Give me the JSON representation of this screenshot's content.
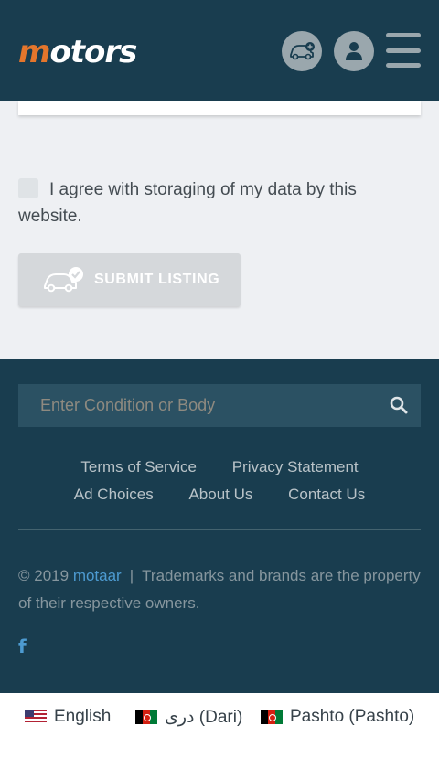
{
  "header": {
    "logo_first": "m",
    "logo_rest": "otors",
    "icons": [
      "car-add-icon",
      "user-icon",
      "menu-icon"
    ]
  },
  "form": {
    "agree_text": "I agree with storaging of my data by this website.",
    "submit_label": "SUBMIT LISTING"
  },
  "footer": {
    "search_placeholder": "Enter Condition or Body",
    "links_row1": [
      "Terms of Service",
      "Privacy Statement"
    ],
    "links_row2": [
      "Ad Choices",
      "About Us",
      "Contact Us"
    ],
    "copyright_prefix": "© 2019",
    "brand": "motaar",
    "separator": "|",
    "copyright_suffix": "Trademarks and brands are the property of their respective owners.",
    "social": "f"
  },
  "languages": [
    "English",
    "دری (Dari)",
    "Pashto (Pashto)"
  ],
  "colors": {
    "header_bg": "#193d4f",
    "logo_accent": "#e4762c",
    "link_accent": "#4d9bd1"
  }
}
